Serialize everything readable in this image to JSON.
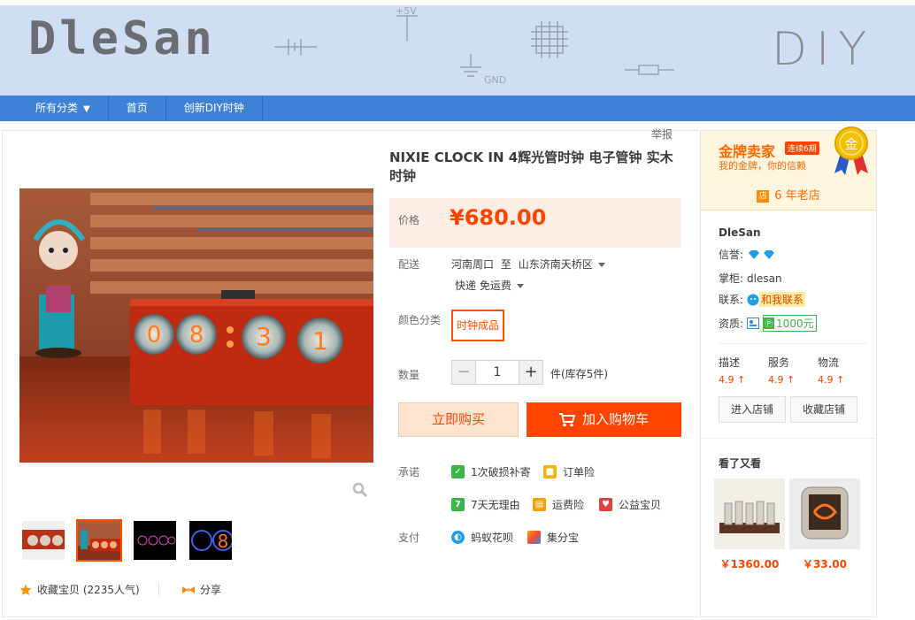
{
  "shop": {
    "logo": "DleSan",
    "banner_text": "DIY",
    "banner_labels": {
      "plus5v": "+5V",
      "gnd": "GND"
    }
  },
  "nav": {
    "items": [
      {
        "label": "所有分类",
        "dropdown": true
      },
      {
        "label": "首页"
      },
      {
        "label": "创新DIY时钟"
      }
    ]
  },
  "report_label": "举报",
  "product": {
    "title": "NIXIE CLOCK IN 4辉光管时钟 电子管钟 实木时钟",
    "price_label": "价格",
    "price": "¥680.00",
    "shipping_label": "配送",
    "shipping_from": "河南周口",
    "shipping_to_word": "至",
    "shipping_to": "山东济南天桥区",
    "shipping_method": "快递 免运费",
    "color_label": "颜色分类",
    "color_option": "时钟成品",
    "qty_label": "数量",
    "qty_value": "1",
    "qty_minus": "−",
    "qty_plus": "+",
    "stock": "件(库存5件)",
    "buy_now": "立即购买",
    "add_to_cart": "加入购物车",
    "promise_label": "承诺",
    "promises": [
      {
        "label": "1次破损补寄",
        "icon": "shield-icon",
        "color": "#3bb54a"
      },
      {
        "label": "订单险",
        "icon": "order-insurance-icon",
        "color": "#f5b400"
      },
      {
        "label": "7天无理由",
        "icon": "seven-day-icon",
        "color": "#3bb54a"
      },
      {
        "label": "运费险",
        "icon": "freight-insurance-icon",
        "color": "#f5a000"
      },
      {
        "label": "公益宝贝",
        "icon": "charity-icon",
        "color": "#e04040"
      }
    ],
    "pay_label": "支付",
    "payments": [
      {
        "label": "蚂蚁花呗",
        "icon": "huabei-icon",
        "color": "#1e9fe8"
      },
      {
        "label": "集分宝",
        "icon": "jifenbao-icon",
        "color": "#f54a3a"
      }
    ],
    "favorite": "收藏宝贝 (2235人气)",
    "share": "分享",
    "clock_digits": "08:31"
  },
  "seller": {
    "gold_title": "金牌卖家",
    "gold_badge": "连续6期",
    "gold_sub": "我的金牌，你的信赖",
    "medal_char": "金",
    "shop_age_icon": "店",
    "shop_age": "6 年老店",
    "name": "DleSan",
    "credit_label": "信誉:",
    "owner_label": "掌柜:",
    "owner": "dlesan",
    "contact_label": "联系:",
    "contact_button": "和我联系",
    "qualification_label": "资质:",
    "deposit": "1000元",
    "scores": [
      {
        "label": "描述",
        "value": "4.9"
      },
      {
        "label": "服务",
        "value": "4.9"
      },
      {
        "label": "物流",
        "value": "4.9"
      }
    ],
    "enter_shop": "进入店铺",
    "fav_shop": "收藏店铺",
    "also_viewed_title": "看了又看",
    "also_viewed": [
      {
        "price": "￥1360.00"
      },
      {
        "price": "￥33.00"
      }
    ]
  },
  "colors": {
    "accent": "#ff4400",
    "nav_blue": "#3f81d6",
    "banner_bg": "#d0def3"
  }
}
